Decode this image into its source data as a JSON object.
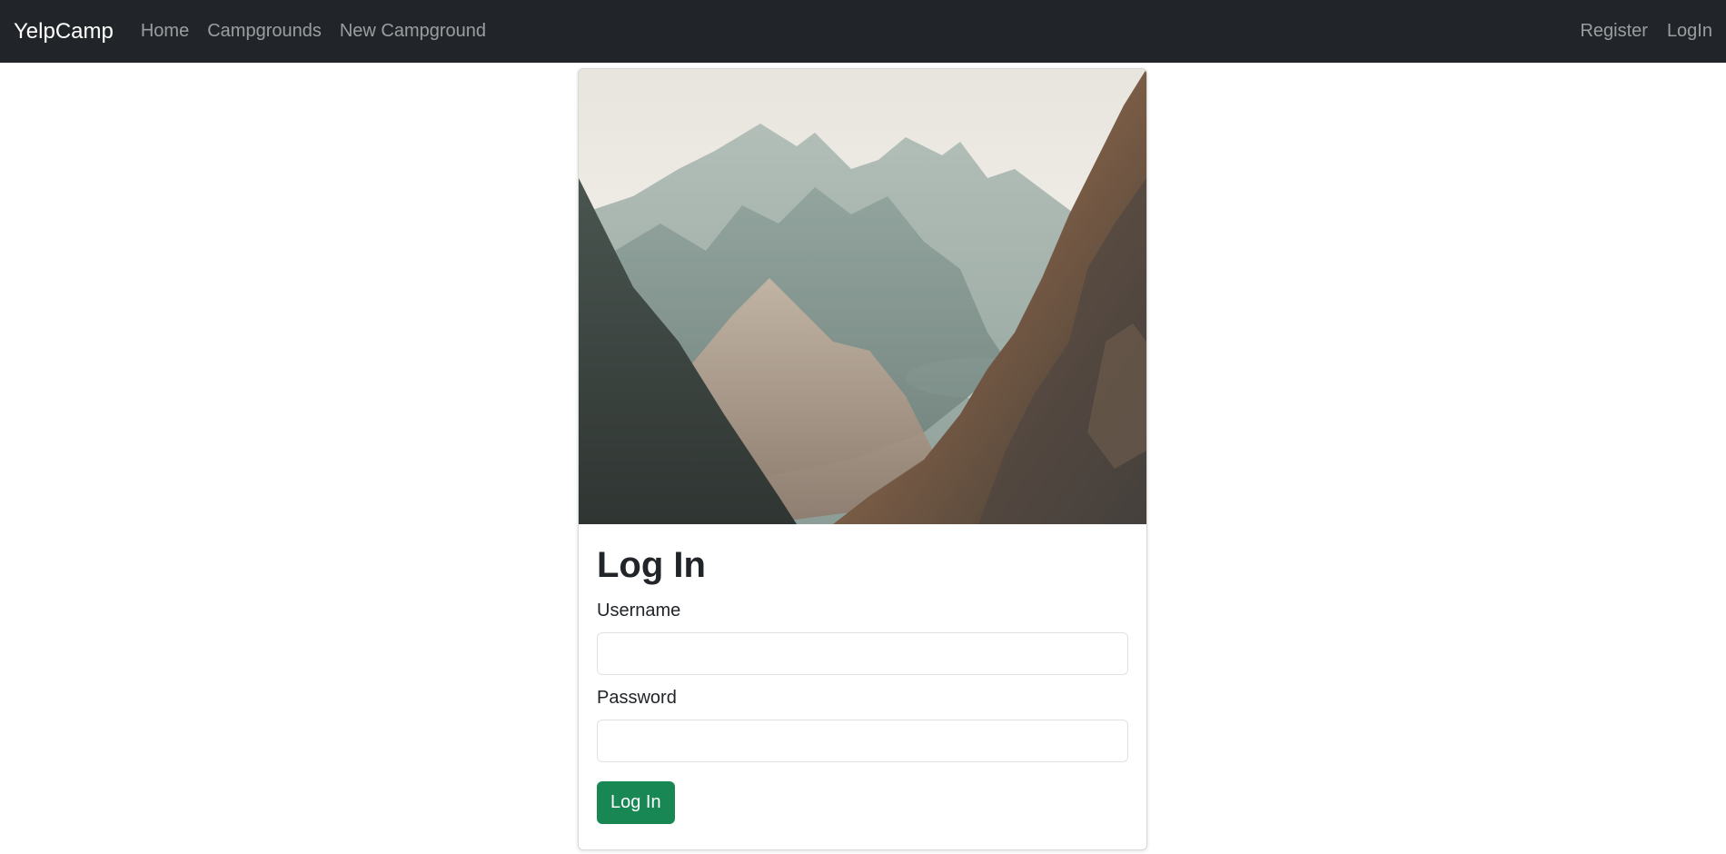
{
  "navbar": {
    "brand": "YelpCamp",
    "links": [
      {
        "label": "Home"
      },
      {
        "label": "Campgrounds"
      },
      {
        "label": "New Campground"
      }
    ],
    "right_links": [
      {
        "label": "Register"
      },
      {
        "label": "LogIn"
      }
    ]
  },
  "card": {
    "image": "mountain-landscape-photo",
    "title": "Log In",
    "username_label": "Username",
    "username_value": "",
    "password_label": "Password",
    "password_value": "",
    "submit_label": "Log In"
  },
  "colors": {
    "navbar_bg": "#212529",
    "button_bg": "#198754"
  }
}
